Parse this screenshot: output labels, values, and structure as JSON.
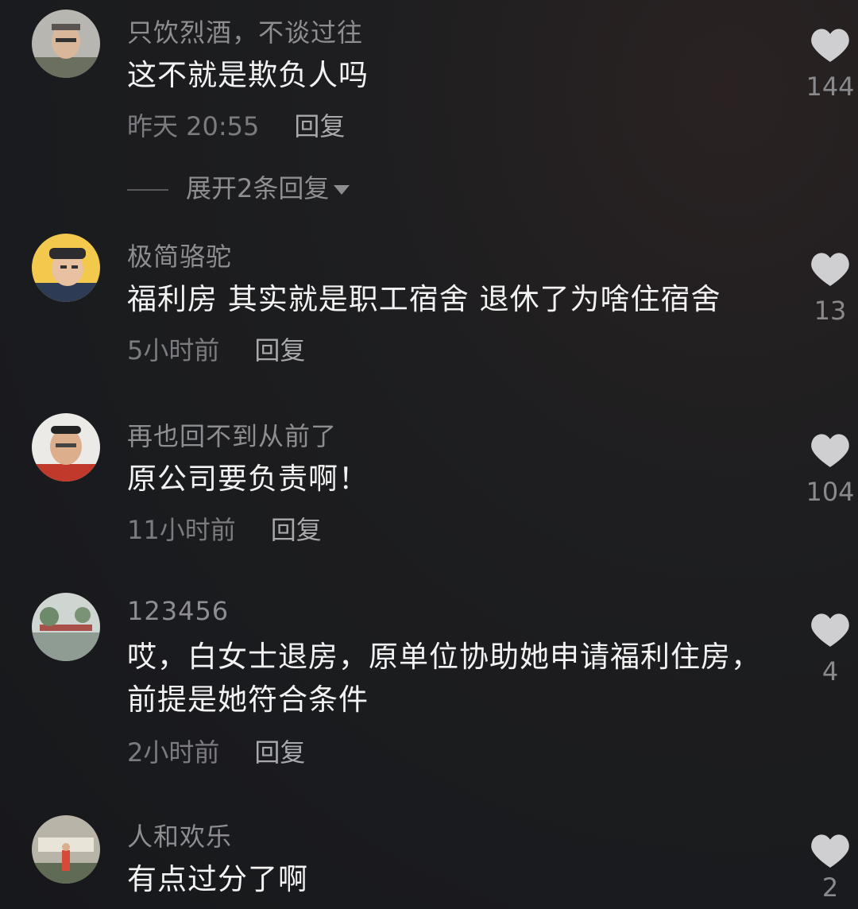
{
  "colors": {
    "background": "#1b1c1f",
    "username": "#8e8e92",
    "text": "#f2f2f2",
    "meta": "#7c7c80",
    "like_icon": "#cfcfd1"
  },
  "comments": [
    {
      "username": "只饮烈酒，不谈过往",
      "text": "这不就是欺负人吗",
      "time": "昨天 20:55",
      "reply_label": "回复",
      "likes": "144",
      "expand_label": "展开2条回复",
      "avatar_icon": "user-avatar-icon",
      "like_icon": "heart-icon"
    },
    {
      "username": "极简骆驼",
      "text": "福利房 其实就是职工宿舍 退休了为啥住宿舍",
      "time": "5小时前",
      "reply_label": "回复",
      "likes": "13",
      "avatar_icon": "user-avatar-icon",
      "like_icon": "heart-icon"
    },
    {
      "username": "再也回不到从前了",
      "text": "原公司要负责啊！",
      "time": "11小时前",
      "reply_label": "回复",
      "likes": "104",
      "avatar_icon": "user-avatar-icon",
      "like_icon": "heart-icon"
    },
    {
      "username": "123456",
      "text": "哎，白女士退房，原单位协助她申请福利住房，前提是她符合条件",
      "time": "2小时前",
      "reply_label": "回复",
      "likes": "4",
      "avatar_icon": "user-avatar-icon",
      "like_icon": "heart-icon"
    },
    {
      "username": "人和欢乐",
      "text": "有点过分了啊",
      "likes": "2",
      "avatar_icon": "user-avatar-icon",
      "like_icon": "heart-icon"
    }
  ]
}
